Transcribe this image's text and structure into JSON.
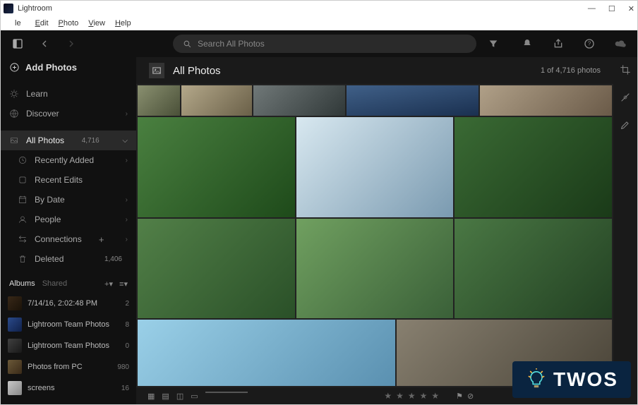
{
  "window": {
    "title": "Lightroom"
  },
  "menu": {
    "items": [
      "le",
      "Edit",
      "Photo",
      "View",
      "Help"
    ]
  },
  "search": {
    "placeholder": "Search All Photos"
  },
  "sidebar": {
    "add": "Add Photos",
    "learn": "Learn",
    "discover": "Discover",
    "all": {
      "label": "All Photos",
      "count": "4,716"
    },
    "recent_added": "Recently Added",
    "recent_edits": "Recent Edits",
    "by_date": "By Date",
    "people": "People",
    "connections": "Connections",
    "deleted": {
      "label": "Deleted",
      "count": "1,406"
    },
    "albums_label": "Albums",
    "shared_label": "Shared",
    "albums": [
      {
        "name": "7/14/16, 2:02:48 PM",
        "count": "2"
      },
      {
        "name": "Lightroom Team Photos",
        "count": "8"
      },
      {
        "name": "Lightroom Team Photos",
        "count": "0"
      },
      {
        "name": "Photos from PC",
        "count": "980"
      },
      {
        "name": "screens",
        "count": "16"
      }
    ]
  },
  "header": {
    "title": "All Photos",
    "count": "1 of 4,716 photos"
  },
  "badge": {
    "text": "TWOS"
  }
}
